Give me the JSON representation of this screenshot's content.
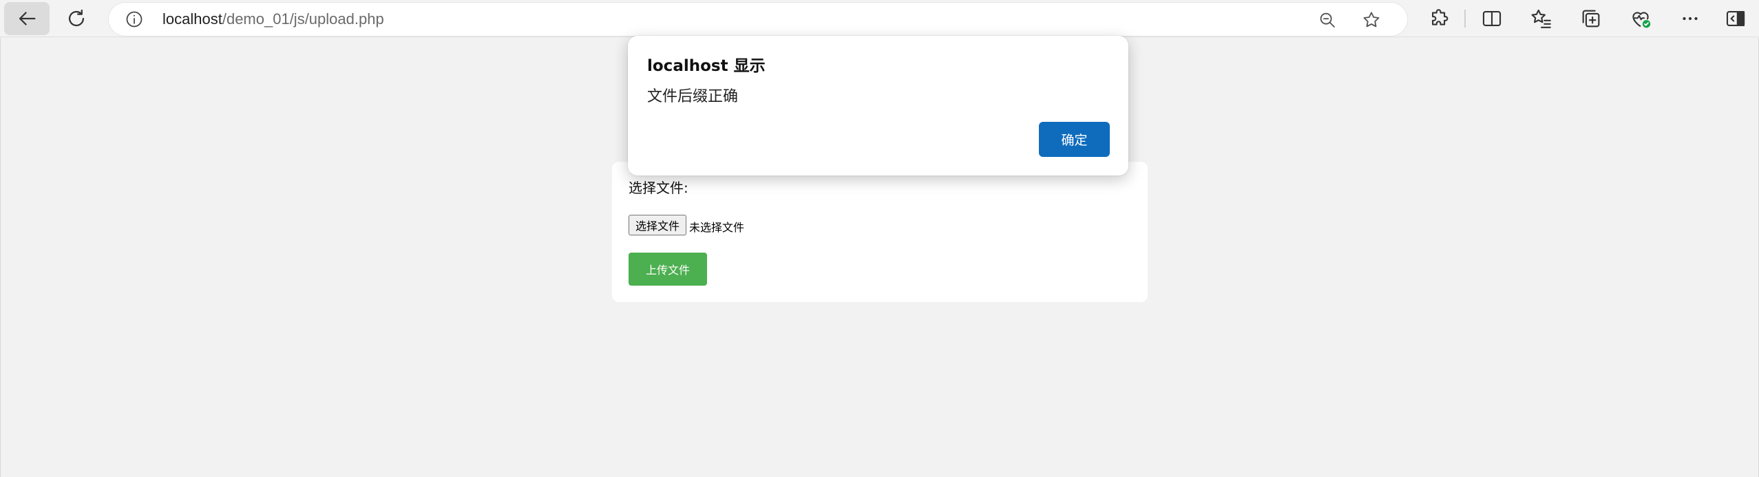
{
  "browser": {
    "url_host": "localhost",
    "url_path": "/demo_01/js/upload.php",
    "icons": {
      "back": "back-arrow-icon",
      "refresh": "refresh-icon",
      "info": "info-icon",
      "zoom": "zoom-out-icon",
      "favorite": "star-icon",
      "extensions": "puzzle-icon",
      "split": "split-screen-icon",
      "favorites": "favorites-list-icon",
      "collections": "collections-icon",
      "health": "browser-essentials-icon",
      "more": "more-icon",
      "sidebar": "sidebar-icon"
    }
  },
  "page": {
    "upload_form": {
      "label": "选择文件:",
      "file_button": "选择文件",
      "file_status": "未选择文件",
      "upload_button": "上传文件",
      "upload_color": "#4caf50"
    }
  },
  "dialog": {
    "title": "localhost 显示",
    "message": "文件后缀正确",
    "ok_button": "确定",
    "accent_color": "#0f6cbd"
  }
}
